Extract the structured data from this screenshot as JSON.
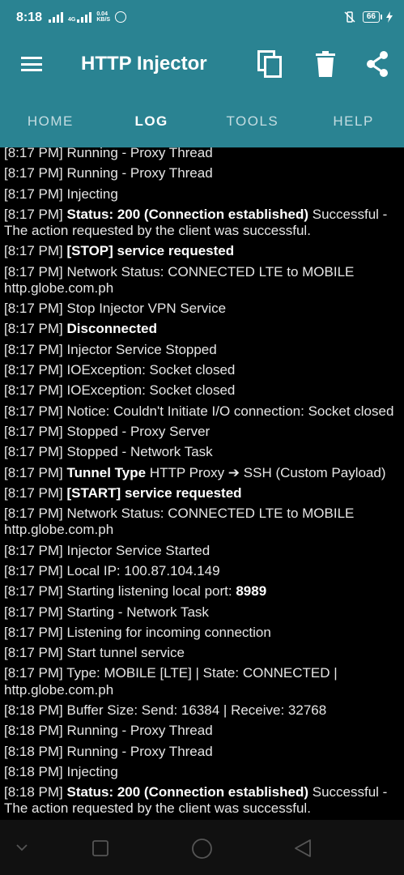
{
  "status_bar": {
    "time": "8:18",
    "network_type": "4G",
    "speed_value": "0.04",
    "speed_unit": "KB/S",
    "battery": "66"
  },
  "app_bar": {
    "title": "HTTP Injector",
    "icons": [
      "menu-icon",
      "copy-icon",
      "delete-icon",
      "share-icon"
    ]
  },
  "tabs": [
    {
      "label": "HOME",
      "active": false
    },
    {
      "label": "LOG",
      "active": true
    },
    {
      "label": "TOOLS",
      "active": false
    },
    {
      "label": "HELP",
      "active": false
    }
  ],
  "log": [
    {
      "time": "[8:17 PM]",
      "bold": "",
      "text": "Running - Proxy Thread"
    },
    {
      "time": "[8:17 PM]",
      "bold": "",
      "text": "Running - Proxy Thread"
    },
    {
      "time": "[8:17 PM]",
      "bold": "",
      "text": "Injecting"
    },
    {
      "time": "[8:17 PM]",
      "bold": "Status: 200 (Connection established)",
      "text": "Successful - The action requested by the client was successful."
    },
    {
      "time": "[8:17 PM]",
      "bold": "[STOP] service requested",
      "text": ""
    },
    {
      "time": "[8:17 PM]",
      "bold": "",
      "text": "Network Status: CONNECTED LTE to MOBILE http.globe.com.ph"
    },
    {
      "time": "[8:17 PM]",
      "bold": "",
      "text": "Stop Injector VPN Service"
    },
    {
      "time": "[8:17 PM]",
      "bold": "Disconnected",
      "text": ""
    },
    {
      "time": "[8:17 PM]",
      "bold": "",
      "text": "Injector Service Stopped"
    },
    {
      "time": "[8:17 PM]",
      "bold": "",
      "text": "IOException: Socket closed"
    },
    {
      "time": "[8:17 PM]",
      "bold": "",
      "text": "IOException: Socket closed"
    },
    {
      "time": "[8:17 PM]",
      "bold": "",
      "text": "Notice: Couldn't Initiate I/O connection: Socket closed"
    },
    {
      "time": "[8:17 PM]",
      "bold": "",
      "text": "Stopped - Proxy Server"
    },
    {
      "time": "[8:17 PM]",
      "bold": "",
      "text": "Stopped - Network Task"
    },
    {
      "time": "[8:17 PM]",
      "bold": "Tunnel Type",
      "text": "HTTP Proxy ➔ SSH (Custom Payload)"
    },
    {
      "time": "[8:17 PM]",
      "bold": "[START] service requested",
      "text": ""
    },
    {
      "time": "[8:17 PM]",
      "bold": "",
      "text": "Network Status: CONNECTED LTE to MOBILE http.globe.com.ph"
    },
    {
      "time": "[8:17 PM]",
      "bold": "",
      "text": "Injector Service Started"
    },
    {
      "time": "[8:17 PM]",
      "bold": "",
      "text": "Local IP: 100.87.104.149"
    },
    {
      "time": "[8:17 PM]",
      "bold": "",
      "text": "Starting listening local port:",
      "bold_after": "8989"
    },
    {
      "time": "[8:17 PM]",
      "bold": "",
      "text": "Starting - Network Task"
    },
    {
      "time": "[8:17 PM]",
      "bold": "",
      "text": "Listening for incoming connection"
    },
    {
      "time": "[8:17 PM]",
      "bold": "",
      "text": "Start tunnel service"
    },
    {
      "time": "[8:17 PM]",
      "bold": "",
      "text": "Type: MOBILE [LTE] | State: CONNECTED | http.globe.com.ph"
    },
    {
      "time": "[8:18 PM]",
      "bold": "",
      "text": "Buffer Size: Send: 16384 | Receive: 32768"
    },
    {
      "time": "[8:18 PM]",
      "bold": "",
      "text": "Running - Proxy Thread"
    },
    {
      "time": "[8:18 PM]",
      "bold": "",
      "text": "Running - Proxy Thread"
    },
    {
      "time": "[8:18 PM]",
      "bold": "",
      "text": "Injecting"
    },
    {
      "time": "[8:18 PM]",
      "bold": "Status: 200 (Connection established)",
      "text": "Successful - The action requested by the client was successful."
    }
  ],
  "nav_bar": {
    "icons": [
      "chevron-down-icon",
      "recents-icon",
      "home-icon",
      "back-icon"
    ]
  }
}
